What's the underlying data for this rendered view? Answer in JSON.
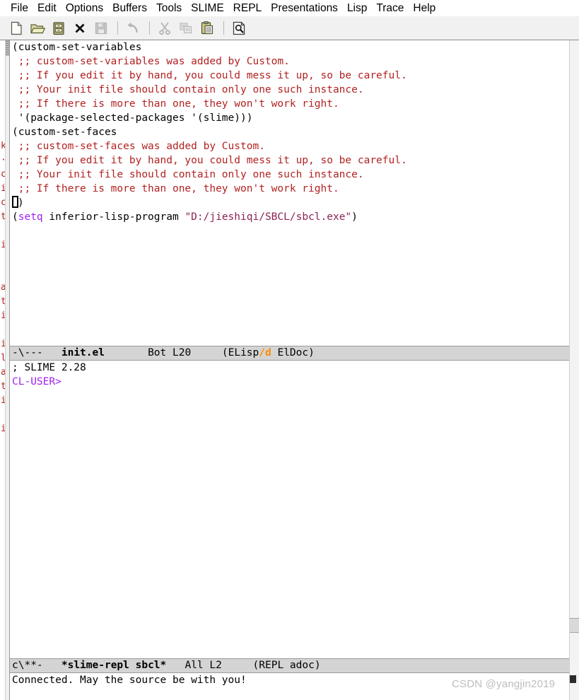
{
  "menubar": {
    "items": [
      {
        "label": "File",
        "name": "menu-file"
      },
      {
        "label": "Edit",
        "name": "menu-edit"
      },
      {
        "label": "Options",
        "name": "menu-options"
      },
      {
        "label": "Buffers",
        "name": "menu-buffers"
      },
      {
        "label": "Tools",
        "name": "menu-tools"
      },
      {
        "label": "SLIME",
        "name": "menu-slime"
      },
      {
        "label": "REPL",
        "name": "menu-repl"
      },
      {
        "label": "Presentations",
        "name": "menu-presentations"
      },
      {
        "label": "Lisp",
        "name": "menu-lisp"
      },
      {
        "label": "Trace",
        "name": "menu-trace"
      },
      {
        "label": "Help",
        "name": "menu-help"
      }
    ]
  },
  "toolbar": {
    "buttons": [
      {
        "icon": "new-file-icon",
        "enabled": true
      },
      {
        "icon": "open-folder-icon",
        "enabled": true
      },
      {
        "icon": "dired-cabinet-icon",
        "enabled": true
      },
      {
        "icon": "close-x-icon",
        "enabled": true
      },
      {
        "icon": "save-floppy-icon",
        "enabled": false
      },
      {
        "icon": "separator",
        "enabled": false
      },
      {
        "icon": "undo-arrow-icon",
        "enabled": false
      },
      {
        "icon": "separator",
        "enabled": false
      },
      {
        "icon": "cut-scissors-icon",
        "enabled": false
      },
      {
        "icon": "copy-pages-icon",
        "enabled": false
      },
      {
        "icon": "paste-clipboard-icon",
        "enabled": true
      },
      {
        "icon": "separator",
        "enabled": false
      },
      {
        "icon": "search-page-icon",
        "enabled": true
      }
    ]
  },
  "left_sliver": {
    "description": "narrow sliver of an adjacent window with clipped glyphs",
    "glyphs": [
      "",
      "",
      "",
      "",
      "",
      "",
      "",
      "k",
      "·",
      "c",
      "i",
      "c",
      "t",
      "",
      "i",
      "",
      "",
      "a",
      "t",
      "i",
      "",
      "i",
      "l",
      "a",
      "t",
      "i",
      "",
      "i",
      "",
      "",
      "",
      "",
      "",
      "",
      "",
      "",
      "",
      "",
      "",
      "",
      "",
      "",
      "",
      "",
      "",
      ""
    ]
  },
  "buffer_init_el": {
    "name": "init.el",
    "lines": [
      {
        "id": 1,
        "segs": [
          {
            "t": "(custom-set-variables",
            "c": "plain"
          }
        ]
      },
      {
        "id": 2,
        "segs": [
          {
            "t": " ;; custom-set-variables was added by Custom.",
            "c": "cmt"
          }
        ]
      },
      {
        "id": 3,
        "segs": [
          {
            "t": " ;; If you edit it by hand, you could mess it up, so be careful.",
            "c": "cmt"
          }
        ]
      },
      {
        "id": 4,
        "segs": [
          {
            "t": " ;; Your init file should contain only one such instance.",
            "c": "cmt"
          }
        ]
      },
      {
        "id": 5,
        "segs": [
          {
            "t": " ;; If there is more than one, they won't work right.",
            "c": "cmt"
          }
        ]
      },
      {
        "id": 6,
        "segs": [
          {
            "t": " '(package-selected-packages '(slime)))",
            "c": "plain"
          }
        ]
      },
      {
        "id": 7,
        "segs": [
          {
            "t": "(custom-set-faces",
            "c": "plain"
          }
        ]
      },
      {
        "id": 8,
        "segs": [
          {
            "t": " ;; custom-set-faces was added by Custom.",
            "c": "cmt"
          }
        ]
      },
      {
        "id": 9,
        "segs": [
          {
            "t": " ;; If you edit it by hand, you could mess it up, so be careful.",
            "c": "cmt"
          }
        ]
      },
      {
        "id": 10,
        "segs": [
          {
            "t": " ;; Your init file should contain only one such instance.",
            "c": "cmt"
          }
        ]
      },
      {
        "id": 11,
        "segs": [
          {
            "t": " ;; If there is more than one, they won't work right.",
            "c": "cmt"
          }
        ]
      },
      {
        "id": 12,
        "cursor": true,
        "segs": [
          {
            "t": ")",
            "c": "plain"
          }
        ]
      },
      {
        "id": 13,
        "segs": [
          {
            "t": "",
            "c": "plain"
          }
        ]
      },
      {
        "id": 14,
        "segs": [
          {
            "t": "",
            "c": "plain"
          }
        ]
      },
      {
        "id": 15,
        "segs": [
          {
            "t": "(",
            "c": "plain"
          },
          {
            "t": "setq",
            "c": "kw"
          },
          {
            "t": " inferior-lisp-program ",
            "c": "plain"
          },
          {
            "t": "\"D:/jieshiqi/SBCL/sbcl.exe\"",
            "c": "str"
          },
          {
            "t": ")",
            "c": "plain"
          }
        ]
      }
    ]
  },
  "modeline_top": {
    "flags": "-\\---",
    "buffer": "init.el",
    "position_pct": "Bot",
    "line": "L20",
    "major_mode_open": "(ELisp",
    "minor_slash": "/d",
    "major_mode_rest": " ElDoc)"
  },
  "buffer_slime_repl": {
    "name": "*slime-repl sbcl*",
    "lines": [
      {
        "id": 1,
        "segs": [
          {
            "t": "; SLIME 2.28",
            "c": "plain"
          }
        ]
      },
      {
        "id": 2,
        "segs": [
          {
            "t": "CL-USER>",
            "c": "prompt"
          }
        ]
      }
    ]
  },
  "modeline_bottom": {
    "flags": "c\\**-",
    "buffer": "*slime-repl sbcl*",
    "position_pct": "All",
    "line": "L2",
    "modes": "(REPL adoc)"
  },
  "echo_area": {
    "message": "Connected. May the source be with you!"
  },
  "watermark": {
    "text": "CSDN @yangjin2019"
  },
  "colors": {
    "comment": "#b22222",
    "keyword": "#a020f0",
    "string": "#8b2252",
    "prompt": "#a020f0",
    "modeline_bg": "#d4d4d4",
    "modeline_accent": "#ff8c00",
    "toolbar_bg": "#f1f1f1",
    "background": "#ffffff"
  }
}
